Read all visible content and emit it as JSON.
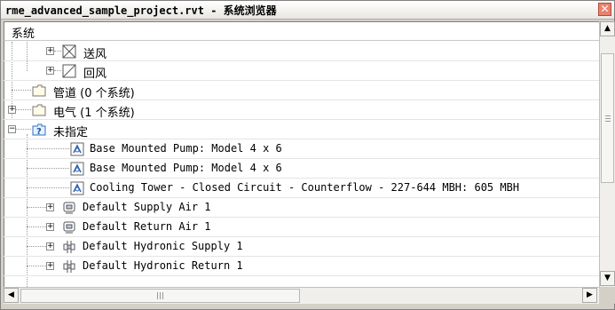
{
  "window": {
    "title": "rme_advanced_sample_project.rvt - 系统浏览器",
    "close_glyph": "✕"
  },
  "header": {
    "label": "系统"
  },
  "tree": [
    {
      "label": "送风",
      "icon": "supply-air-icon"
    },
    {
      "label": "回风",
      "icon": "return-air-icon"
    },
    {
      "label": "管道 (0 个系统)",
      "icon": "folder-icon"
    },
    {
      "label": "电气 (1 个系统)",
      "icon": "folder-icon"
    },
    {
      "label": "未指定",
      "icon": "unassigned-folder-icon"
    },
    {
      "label": "Base Mounted Pump: Model 4 x 6",
      "icon": "pump-component-icon"
    },
    {
      "label": "Base Mounted Pump: Model 4 x 6",
      "icon": "pump-component-icon"
    },
    {
      "label": "Cooling Tower - Closed Circuit - Counterflow - 227-644 MBH: 605 MBH",
      "icon": "cooling-tower-component-icon"
    },
    {
      "label": "Default Supply Air 1",
      "icon": "air-terminal-icon"
    },
    {
      "label": "Default Return Air 1",
      "icon": "air-terminal-icon"
    },
    {
      "label": "Default Hydronic Supply 1",
      "icon": "hydronic-icon"
    },
    {
      "label": "Default Hydronic Return 1",
      "icon": "hydronic-icon"
    }
  ],
  "scrollbar": {
    "up": "▲",
    "down": "▼",
    "left": "◀",
    "right": "▶"
  }
}
